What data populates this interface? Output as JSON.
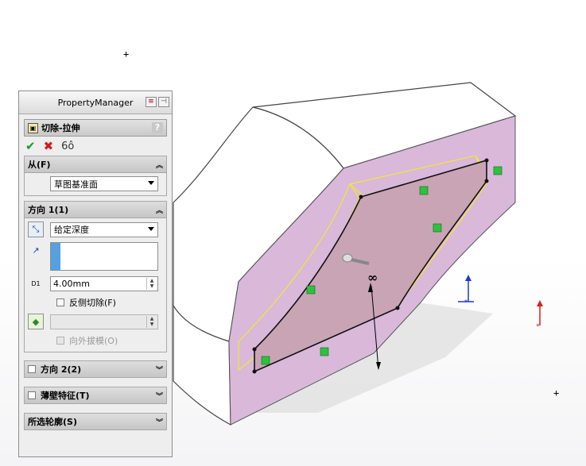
{
  "property_manager": {
    "title": "PropertyManager",
    "feature_title": "切除-拉伸",
    "help": "?",
    "actions": {
      "ok": "✔",
      "cancel": "✖",
      "preview": "6ô"
    },
    "from": {
      "header": "从(F)",
      "selected": "草图基准面"
    },
    "direction1": {
      "header": "方向 1(1)",
      "end_condition": "给定深度",
      "depth_prefix": "D1",
      "depth_value": "4.00mm",
      "flip_side_label": "反侧切除(F)",
      "draft_outward_label": "向外拔模(O)"
    },
    "direction2": {
      "header": "方向 2(2)"
    },
    "thin_feature": {
      "header": "薄壁特征(T)"
    },
    "selected_contours": {
      "header": "所选轮廓(S)"
    }
  },
  "viewport": {
    "depth_symbol": "∞",
    "model_colors": {
      "face": "#d9b8da",
      "body": "#ffffff",
      "cut": "#c9a4b4",
      "preview_edge": "#f2e830"
    }
  }
}
